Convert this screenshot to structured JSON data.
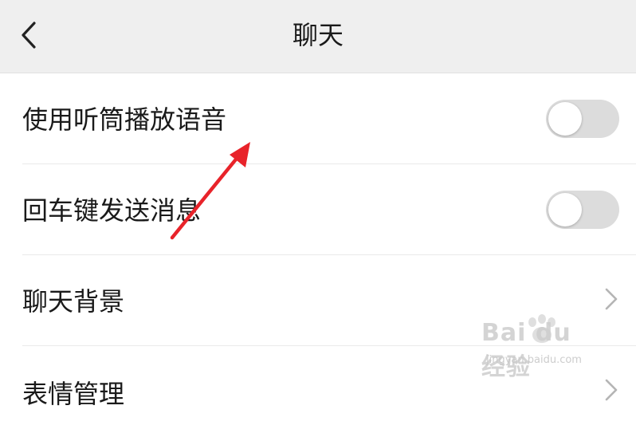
{
  "header": {
    "title": "聊天",
    "back_icon": "chevron-left-icon"
  },
  "settings": {
    "items": [
      {
        "label": "使用听筒播放语音",
        "control": "toggle",
        "checked": false
      },
      {
        "label": "回车键发送消息",
        "control": "toggle",
        "checked": false
      },
      {
        "label": "聊天背景",
        "control": "chevron"
      },
      {
        "label": "表情管理",
        "control": "chevron"
      }
    ]
  },
  "annotation": {
    "type": "red-arrow",
    "color": "#e8232a",
    "points_to": "使用听筒播放语音"
  },
  "watermark": {
    "brand": "Bai du 经验",
    "url": "jingyan.baidu.com"
  },
  "colors": {
    "header_bg": "#efefef",
    "toggle_off": "#dcdcdc",
    "text": "#1a1a1a"
  }
}
